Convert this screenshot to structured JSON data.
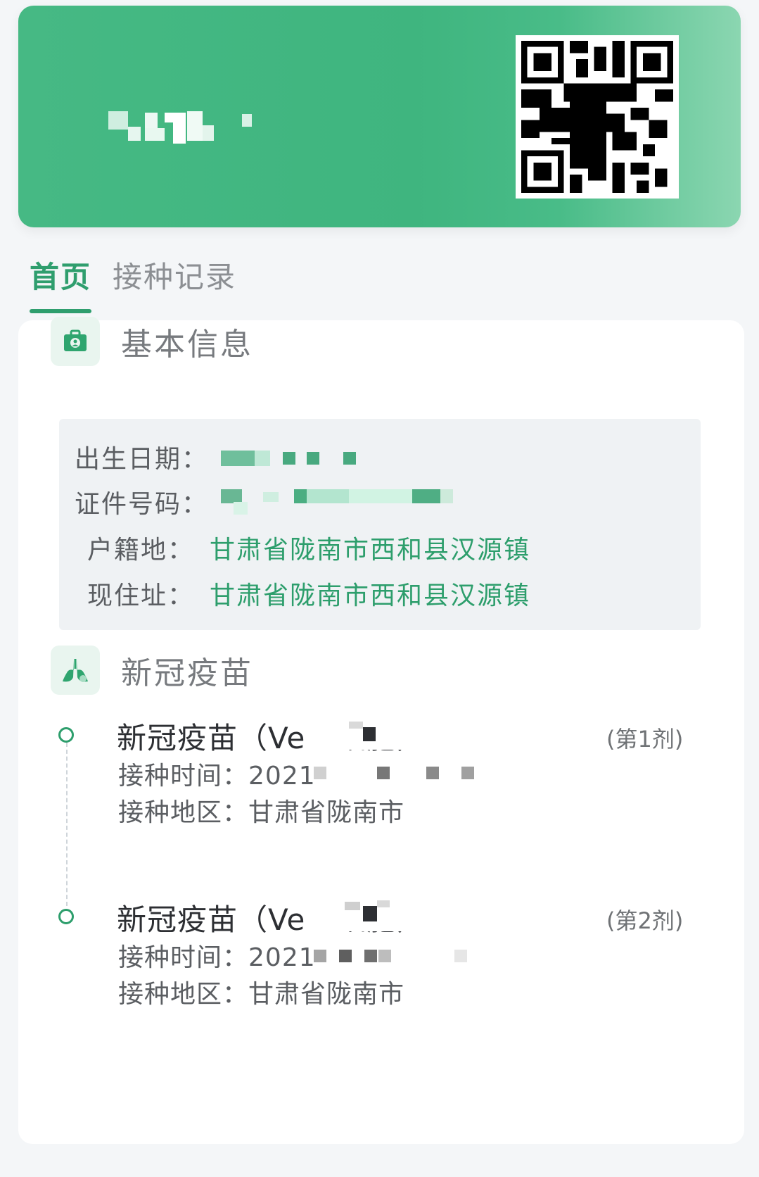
{
  "tabs": [
    {
      "label": "首页",
      "active": true
    },
    {
      "label": "接种记录",
      "active": false
    }
  ],
  "basic_info": {
    "title": "基本信息",
    "fields": [
      {
        "label": "出生日期：",
        "value": ""
      },
      {
        "label": "证件号码：",
        "value": ""
      },
      {
        "label": "户籍地：",
        "value": "甘肃省陇南市西和县汉源镇"
      },
      {
        "label": "现住址：",
        "value": "甘肃省陇南市西和县汉源镇"
      }
    ]
  },
  "vaccine": {
    "title": "新冠疫苗",
    "doses": [
      {
        "name": "新冠疫苗（Vero细胞）",
        "number": "(第1剂)",
        "time_label": "接种时间：",
        "time_value": "2021-",
        "area_label": "接种地区：",
        "area_value": "甘肃省陇南市"
      },
      {
        "name": "新冠疫苗（Vero细胞）",
        "number": "(第2剂)",
        "time_label": "接种时间：",
        "time_value": "2021-",
        "area_label": "接种地区：",
        "area_value": "甘肃省陇南市"
      }
    ]
  },
  "colors": {
    "primary": "#2d9e6c",
    "header_green": "#43b882",
    "text_dark": "#2d2f33",
    "text_gray": "#5b5e62"
  },
  "icons": {
    "basic_info": "medical-kit-icon",
    "vaccine": "lungs-icon"
  }
}
